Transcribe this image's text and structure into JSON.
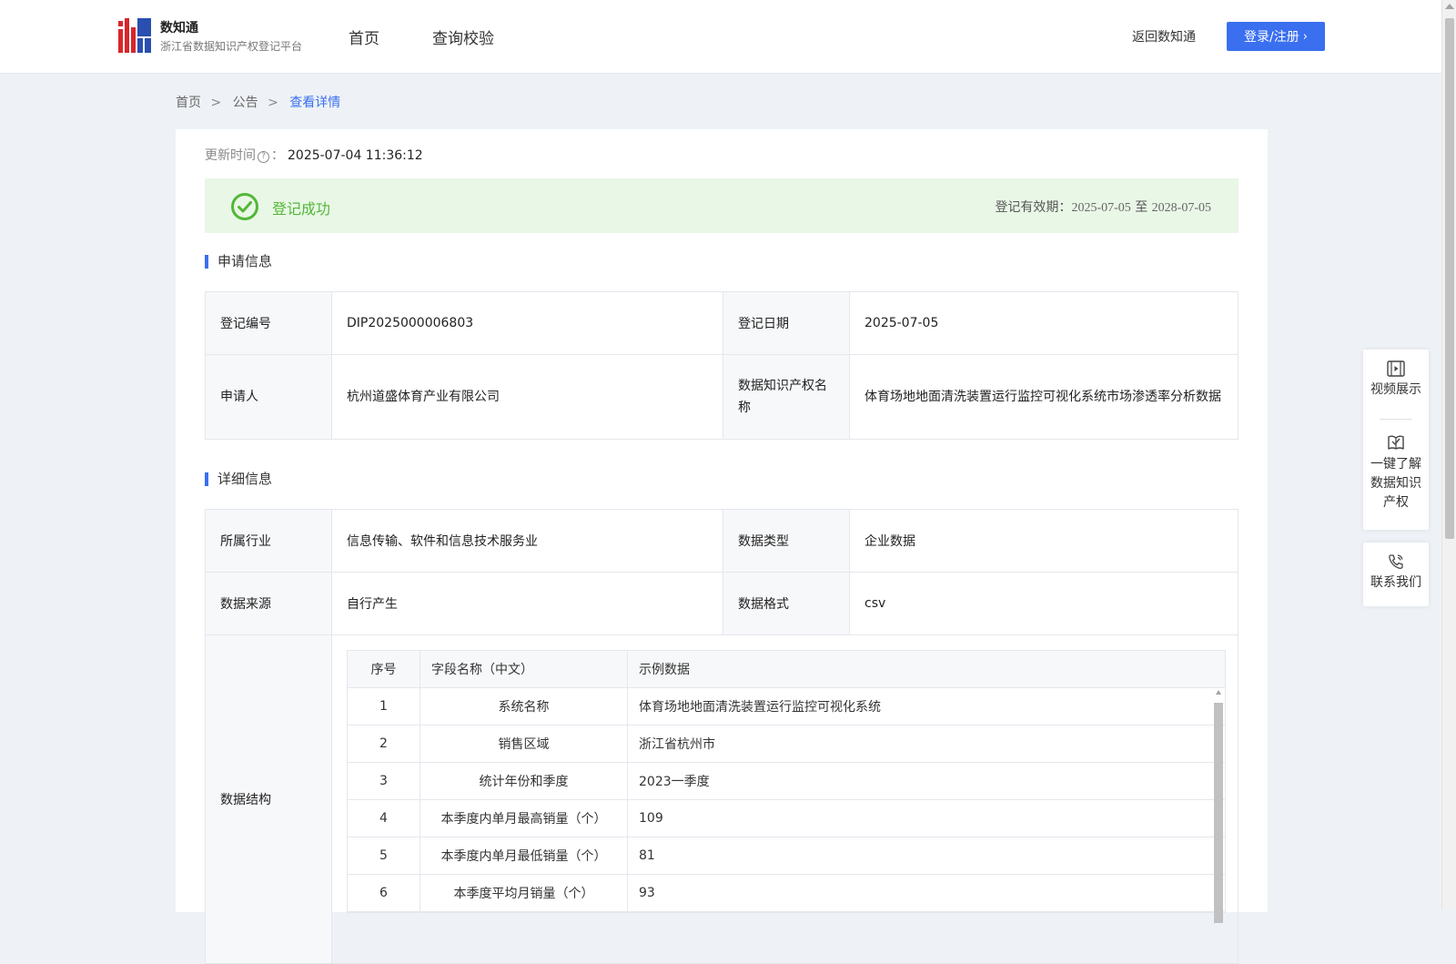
{
  "header": {
    "brand_title": "数知通",
    "brand_subtitle": "浙江省数据知识产权登记平台",
    "nav": [
      "首页",
      "查询校验"
    ],
    "return_link": "返回数知通",
    "login_button": "登录/注册"
  },
  "breadcrumb": [
    "首页",
    "公告",
    "查看详情"
  ],
  "breadcrumb_sep": ">",
  "update": {
    "label": "更新时间",
    "colon": "：",
    "value": "2025-07-04 11:36:12"
  },
  "status": {
    "text": "登记成功",
    "validity_label": "登记有效期：",
    "validity_from": "2025-07-05",
    "validity_to_word": "至",
    "validity_to": "2028-07-05",
    "color": "#52b737"
  },
  "section_apply": "申请信息",
  "section_detail": "详细信息",
  "apply": {
    "reg_no_label": "登记编号",
    "reg_no": "DIP2025000006803",
    "reg_date_label": "登记日期",
    "reg_date": "2025-07-05",
    "applicant_label": "申请人",
    "applicant": "杭州道盛体育产业有限公司",
    "name_label": "数据知识产权名称",
    "name": "体育场地地面清洗装置运行监控可视化系统市场渗透率分析数据"
  },
  "detail": {
    "industry_label": "所属行业",
    "industry": "信息传输、软件和信息技术服务业",
    "type_label": "数据类型",
    "type": "企业数据",
    "source_label": "数据来源",
    "source": "自行产生",
    "format_label": "数据格式",
    "format": "csv",
    "structure_label": "数据结构"
  },
  "structure": {
    "headers": [
      "序号",
      "字段名称（中文）",
      "示例数据"
    ],
    "rows": [
      [
        "1",
        "系统名称",
        "体育场地地面清洗装置运行监控可视化系统"
      ],
      [
        "2",
        "销售区域",
        "浙江省杭州市"
      ],
      [
        "3",
        "统计年份和季度",
        "2023一季度"
      ],
      [
        "4",
        "本季度内单月最高销量（个）",
        "109"
      ],
      [
        "5",
        "本季度内单月最低销量（个）",
        "81"
      ],
      [
        "6",
        "本季度平均月销量（个）",
        "93"
      ]
    ]
  },
  "float_panel": {
    "video": "视频展示",
    "learn": [
      "一键了解",
      "数据知识",
      "产权"
    ],
    "contact": "联系我们"
  },
  "colors": {
    "accent": "#3a6ff0",
    "success_bg": "#e9f7e6",
    "page_bg": "#eef2f6"
  }
}
